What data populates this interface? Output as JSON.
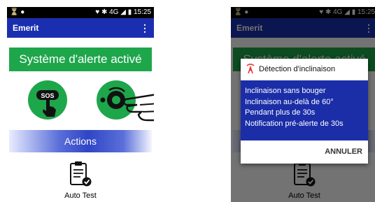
{
  "statusbar": {
    "left_icons": "⏳ ●",
    "right": "♥ ✱ 4G ◢ ▮ 15:25"
  },
  "app": {
    "title": "Emerit",
    "menu_icon": "⋮"
  },
  "main": {
    "banner": "Système d'alerte activé",
    "actions_label": "Actions",
    "autotest_label": "Auto Test"
  },
  "dialog": {
    "title": "Détection d'inclinaison",
    "lines": [
      "Inclinaison sans bouger",
      "Inclinaison au-delà de 60°",
      "Pendant plus de 30s",
      "Notification pré-alerte de 30s"
    ],
    "cancel": "ANNULER"
  },
  "colors": {
    "appbar": "#1a2fb0",
    "green": "#1ea64b",
    "dialog_body": "#1b2ea8",
    "accent_red": "#e53935"
  }
}
